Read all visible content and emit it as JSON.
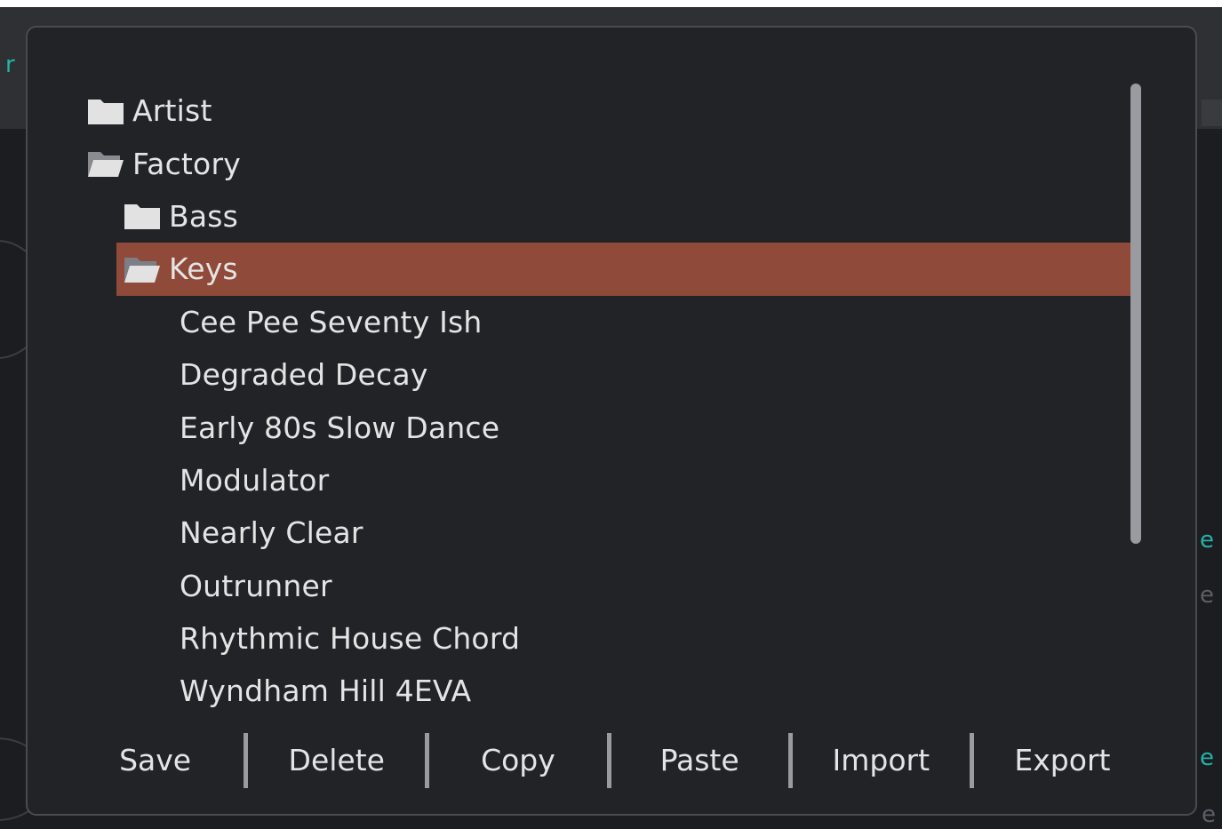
{
  "background": {
    "glyphs": [
      "r",
      "e",
      "e",
      "e",
      "e"
    ]
  },
  "tree": {
    "items": [
      {
        "label": "Artist",
        "type": "folder",
        "open": false
      },
      {
        "label": "Factory",
        "type": "folder",
        "open": true
      },
      {
        "label": "Bass",
        "type": "folder",
        "open": false
      },
      {
        "label": "Keys",
        "type": "folder",
        "open": true,
        "selected": true
      },
      {
        "label": "Cee Pee Seventy Ish",
        "type": "preset"
      },
      {
        "label": "Degraded Decay",
        "type": "preset"
      },
      {
        "label": "Early 80s Slow Dance",
        "type": "preset"
      },
      {
        "label": "Modulator",
        "type": "preset"
      },
      {
        "label": "Nearly Clear",
        "type": "preset"
      },
      {
        "label": "Outrunner",
        "type": "preset"
      },
      {
        "label": "Rhythmic House Chord",
        "type": "preset"
      },
      {
        "label": "Wyndham Hill 4EVA",
        "type": "preset"
      }
    ]
  },
  "toolbar": {
    "save_label": "Save",
    "delete_label": "Delete",
    "copy_label": "Copy",
    "paste_label": "Paste",
    "import_label": "Import",
    "export_label": "Export"
  },
  "colors": {
    "selection": "#8f4a39",
    "accent": "#25b3a8",
    "dialog_bg": "#222327",
    "text": "#e4e4e4"
  },
  "icons": {
    "folder_closed": "folder-icon",
    "folder_open": "folder-open-icon"
  }
}
